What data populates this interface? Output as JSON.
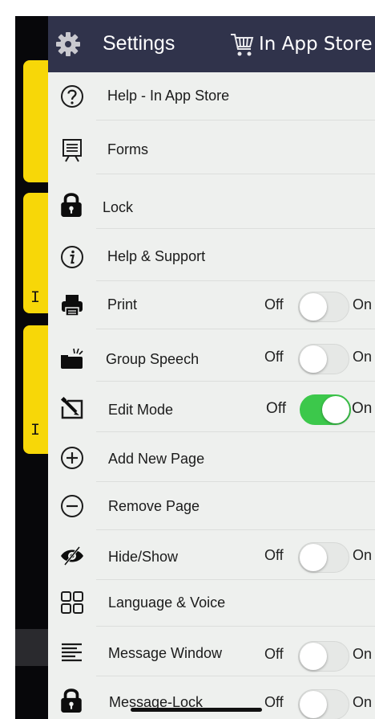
{
  "background": {
    "letters": [
      "I",
      "I"
    ]
  },
  "header": {
    "title": "Settings",
    "store_label": "In App Store",
    "gear_icon": "gear-icon",
    "cart_icon": "shopping-cart-icon"
  },
  "toggle_text": {
    "off": "Off",
    "on": "On"
  },
  "menu": [
    {
      "label": "Help - In App Store",
      "icon": "question-circle-icon",
      "toggle": null
    },
    {
      "label": "Forms",
      "icon": "forms-easel-icon",
      "toggle": null
    },
    {
      "label": "Lock",
      "icon": "padlock-icon",
      "toggle": null
    },
    {
      "label": "Help & Support",
      "icon": "info-circle-icon",
      "toggle": null
    },
    {
      "label": "Print",
      "icon": "printer-icon",
      "toggle": "off"
    },
    {
      "label": "Group Speech",
      "icon": "group-speech-icon",
      "toggle": "off"
    },
    {
      "label": "Edit Mode",
      "icon": "edit-mode-icon",
      "toggle": "on"
    },
    {
      "label": "Add New Page",
      "icon": "plus-circle-icon",
      "toggle": null
    },
    {
      "label": "Remove Page",
      "icon": "minus-circle-icon",
      "toggle": null
    },
    {
      "label": "Hide/Show",
      "icon": "eye-slash-icon",
      "toggle": "off"
    },
    {
      "label": "Language & Voice",
      "icon": "grid-icon",
      "toggle": null
    },
    {
      "label": "Message Window",
      "icon": "text-lines-icon",
      "toggle": "off"
    },
    {
      "label": "Message-Lock",
      "icon": "padlock-icon",
      "toggle": "off"
    }
  ]
}
